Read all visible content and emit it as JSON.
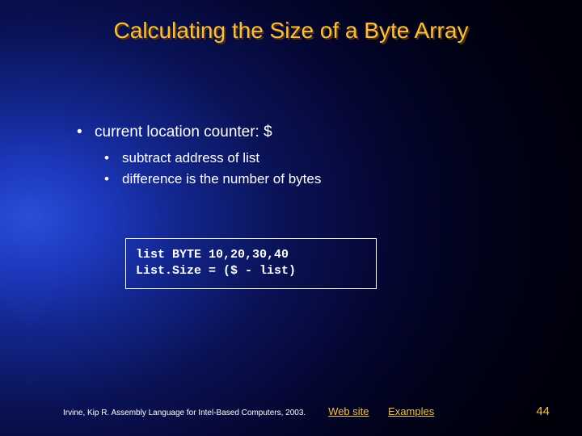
{
  "title": "Calculating the Size of a Byte Array",
  "bullets": {
    "main": "current location counter: $",
    "sub1": "subtract address of list",
    "sub2": "difference is the number of bytes"
  },
  "code": "list BYTE 10,20,30,40\nList.Size = ($ - list)",
  "footer": {
    "citation": "Irvine, Kip R. Assembly Language for Intel-Based Computers, 2003.",
    "link_web": "Web site",
    "link_examples": "Examples",
    "page": "44"
  }
}
